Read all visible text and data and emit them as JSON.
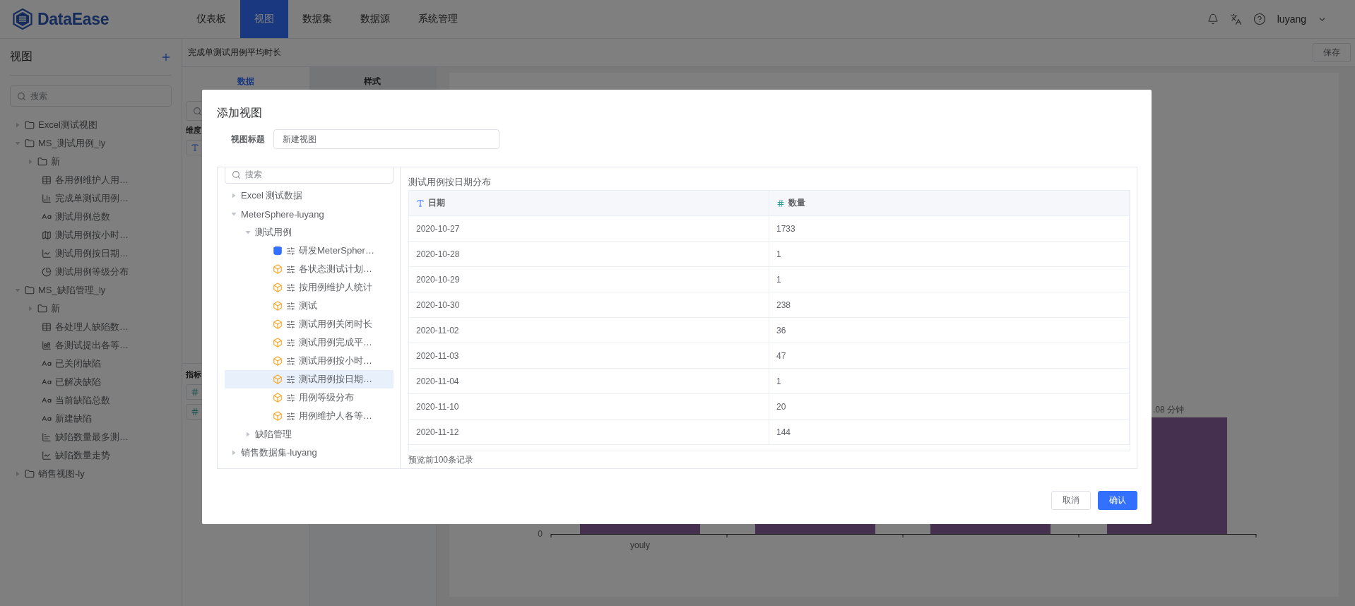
{
  "header": {
    "logo": "DataEase",
    "nav": [
      {
        "label": "仪表板",
        "selected": false
      },
      {
        "label": "视图",
        "selected": true
      },
      {
        "label": "数据集",
        "selected": false
      },
      {
        "label": "数据源",
        "selected": false
      },
      {
        "label": "系统管理",
        "selected": false
      }
    ],
    "user": "luyang"
  },
  "sidebar": {
    "title": "视图",
    "search_placeholder": "搜索",
    "tree": [
      {
        "label": "Excel测试视图",
        "kind": "folder",
        "expanded": false
      },
      {
        "label": "MS_测试用例_ly",
        "kind": "folder",
        "expanded": true,
        "children": [
          {
            "label": "新",
            "kind": "folder",
            "expanded": false
          },
          {
            "label": "各用例维护人用…",
            "kind": "table"
          },
          {
            "label": "完成单测试用例…",
            "kind": "bar"
          },
          {
            "label": "测试用例总数",
            "kind": "text"
          },
          {
            "label": "测试用例按小时…",
            "kind": "map"
          },
          {
            "label": "测试用例按日期…",
            "kind": "line"
          },
          {
            "label": "测试用例等级分布",
            "kind": "pie"
          }
        ]
      },
      {
        "label": "MS_缺陷管理_ly",
        "kind": "folder",
        "expanded": true,
        "children": [
          {
            "label": "新",
            "kind": "folder",
            "expanded": false
          },
          {
            "label": "各处理人缺陷数…",
            "kind": "table"
          },
          {
            "label": "各测试提出各等…",
            "kind": "stacked"
          },
          {
            "label": "已关闭缺陷",
            "kind": "text"
          },
          {
            "label": "已解决缺陷",
            "kind": "text"
          },
          {
            "label": "当前缺陷总数",
            "kind": "text"
          },
          {
            "label": "新建缺陷",
            "kind": "text"
          },
          {
            "label": "缺陷数量最多测…",
            "kind": "hbar"
          },
          {
            "label": "缺陷数量走势",
            "kind": "line"
          }
        ]
      },
      {
        "label": "销售视图-ly",
        "kind": "folder",
        "expanded": false
      }
    ]
  },
  "editor": {
    "title": "完成单测试用例平均时长",
    "save_button": "保存",
    "tabs": [
      {
        "label": "数据",
        "selected": true
      },
      {
        "label": "样式",
        "selected": false
      }
    ],
    "dimension_label": "维度",
    "metric_label": "指标"
  },
  "chart": {
    "axis_label": "0",
    "category_label": "youly",
    "value_label": ".08 分钟"
  },
  "dialog": {
    "title": "添加视图",
    "title_field": {
      "label": "视图标题",
      "value": "新建视图"
    },
    "search_placeholder": "搜索",
    "tree": [
      {
        "label": "Excel 测试数据",
        "kind": "group",
        "expanded": false
      },
      {
        "label": "MeterSphere-luyang",
        "kind": "group",
        "expanded": true,
        "children": [
          {
            "label": "测试用例",
            "kind": "group",
            "expanded": true,
            "children": [
              {
                "label": "研发MeterSpher…",
                "kind": "db",
                "selected": false
              },
              {
                "label": "各状态测试计划…",
                "kind": "sql",
                "selected": false
              },
              {
                "label": "按用例维护人统计",
                "kind": "sql",
                "selected": false
              },
              {
                "label": "测试",
                "kind": "sql",
                "selected": false
              },
              {
                "label": "测试用例关闭时长",
                "kind": "sql",
                "selected": false
              },
              {
                "label": "测试用例完成平…",
                "kind": "sql",
                "selected": false
              },
              {
                "label": "测试用例按小时…",
                "kind": "sql",
                "selected": false
              },
              {
                "label": "测试用例按日期…",
                "kind": "sql",
                "selected": true
              },
              {
                "label": "用例等级分布",
                "kind": "sql",
                "selected": false
              },
              {
                "label": "用例维护人各等…",
                "kind": "sql",
                "selected": false
              }
            ]
          },
          {
            "label": "缺陷管理",
            "kind": "group",
            "expanded": false
          }
        ]
      },
      {
        "label": "销售数据集-luyang",
        "kind": "group",
        "expanded": false
      }
    ],
    "preview": {
      "caption": "测试用例按日期分布",
      "columns": [
        {
          "label": "日期",
          "kind": "text"
        },
        {
          "label": "数量",
          "kind": "number"
        }
      ],
      "rows": [
        [
          "2020-10-27",
          "1733"
        ],
        [
          "2020-10-28",
          "1"
        ],
        [
          "2020-10-29",
          "1"
        ],
        [
          "2020-10-30",
          "238"
        ],
        [
          "2020-11-02",
          "36"
        ],
        [
          "2020-11-03",
          "47"
        ],
        [
          "2020-11-04",
          "1"
        ],
        [
          "2020-11-10",
          "20"
        ],
        [
          "2020-11-12",
          "144"
        ]
      ],
      "note": "预览前100条记录"
    },
    "buttons": [
      {
        "label": "取消",
        "kind": "secondary"
      },
      {
        "label": "确认",
        "kind": "primary"
      }
    ]
  }
}
